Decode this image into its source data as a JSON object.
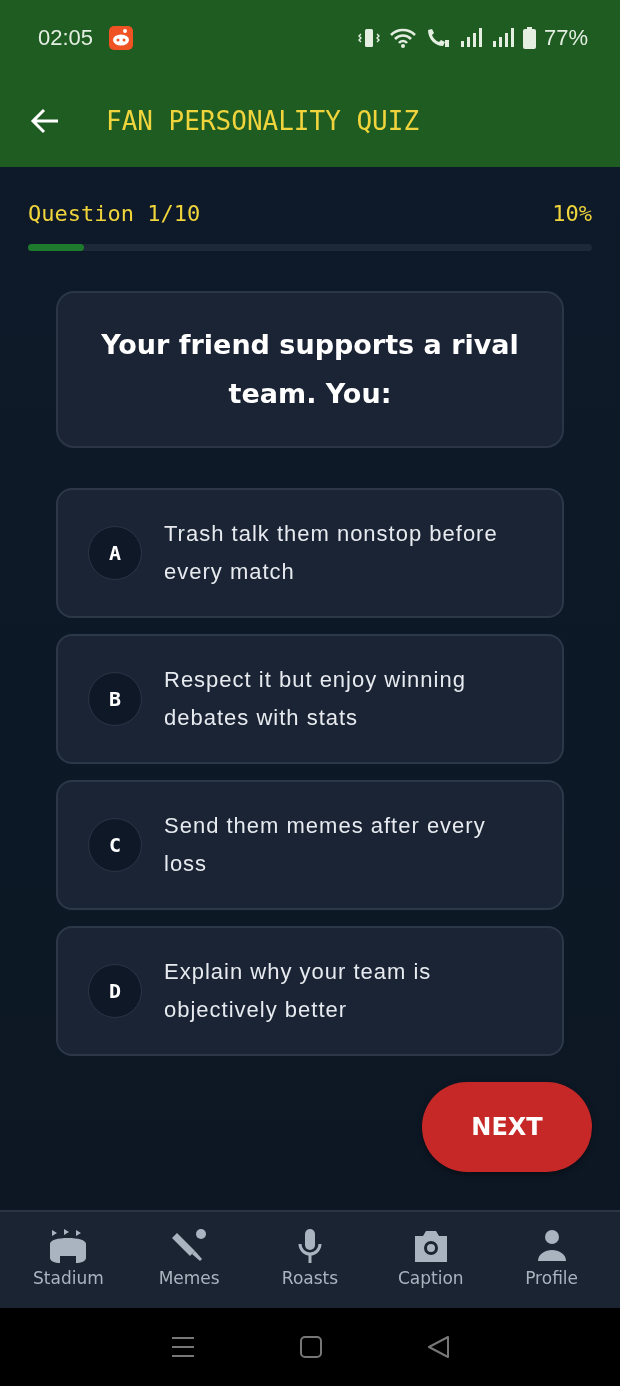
{
  "status_bar": {
    "time": "02:05",
    "battery": "77%"
  },
  "header": {
    "title": "FAN PERSONALITY QUIZ"
  },
  "progress": {
    "label": "Question 1/10",
    "percent": "10%",
    "level": 0.1
  },
  "question": "Your friend supports a rival team. You:",
  "options": [
    {
      "letter": "A",
      "text": "Trash talk them nonstop before every match",
      "selected": false
    },
    {
      "letter": "B",
      "text": "Respect it but enjoy winning debates with stats",
      "selected": false
    },
    {
      "letter": "C",
      "text": "Send them memes after every loss",
      "selected": false
    },
    {
      "letter": "D",
      "text": "Explain why your team is objectively better",
      "selected": false
    }
  ],
  "next_button": "NEXT",
  "bottom_nav": [
    {
      "kind": "stadium",
      "label": "Stadium",
      "selected": false
    },
    {
      "kind": "bat",
      "label": "Memes",
      "selected": false
    },
    {
      "kind": "mic",
      "label": "Roasts",
      "selected": false
    },
    {
      "kind": "camera",
      "label": "Caption",
      "selected": false
    },
    {
      "kind": "person",
      "label": "Profile",
      "selected": false
    }
  ]
}
